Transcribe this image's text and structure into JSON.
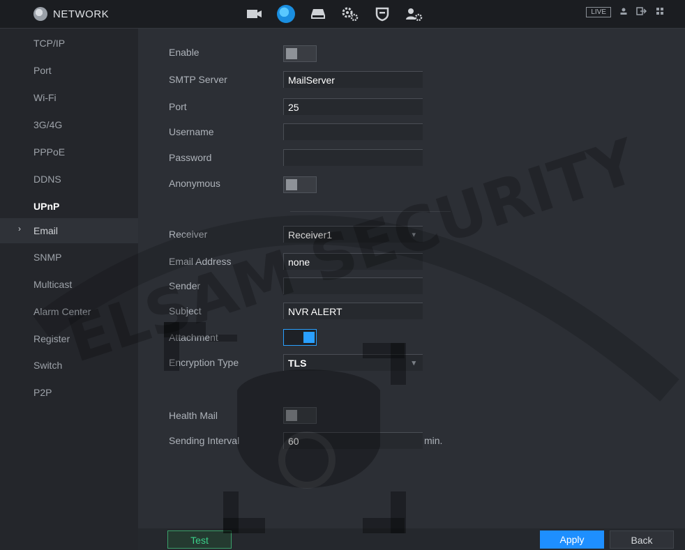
{
  "header": {
    "title": "NETWORK",
    "nav_icons": [
      "camera-icon",
      "network-globe-icon",
      "storage-icon",
      "settings-gears-icon",
      "shield-icon",
      "account-gear-icon"
    ],
    "live_label": "LIVE"
  },
  "sidebar": {
    "items": [
      {
        "label": "TCP/IP"
      },
      {
        "label": "Port"
      },
      {
        "label": "Wi-Fi"
      },
      {
        "label": "3G/4G"
      },
      {
        "label": "PPPoE"
      },
      {
        "label": "DDNS"
      },
      {
        "label": "UPnP"
      },
      {
        "label": "Email"
      },
      {
        "label": "SNMP"
      },
      {
        "label": "Multicast"
      },
      {
        "label": "Alarm Center"
      },
      {
        "label": "Register"
      },
      {
        "label": "Switch"
      },
      {
        "label": "P2P"
      }
    ],
    "current": "Email",
    "bold": "UPnP"
  },
  "form": {
    "enable": {
      "label": "Enable",
      "on": false
    },
    "smtp_server": {
      "label": "SMTP Server",
      "value": "MailServer"
    },
    "port": {
      "label": "Port",
      "value": "25"
    },
    "username": {
      "label": "Username",
      "value": ""
    },
    "password": {
      "label": "Password",
      "value": ""
    },
    "anonymous": {
      "label": "Anonymous",
      "on": false
    },
    "receiver": {
      "label": "Receiver",
      "value": "Receiver1"
    },
    "email_address": {
      "label": "Email Address",
      "value": "none"
    },
    "sender": {
      "label": "Sender",
      "value": ""
    },
    "subject": {
      "label": "Subject",
      "value": "NVR ALERT"
    },
    "attachment": {
      "label": "Attachment",
      "on": true
    },
    "encryption_type": {
      "label": "Encryption Type",
      "value": "TLS"
    },
    "health_mail": {
      "label": "Health Mail",
      "on": false
    },
    "sending_interval": {
      "label": "Sending Interval",
      "value": "60",
      "unit": "min."
    }
  },
  "buttons": {
    "test": "Test",
    "apply": "Apply",
    "back": "Back"
  },
  "watermark": "ELSAM SECURITY",
  "colors": {
    "accent": "#1e8fff",
    "toggle_on": "#2aa0ff",
    "test_green": "#3bd08a"
  }
}
